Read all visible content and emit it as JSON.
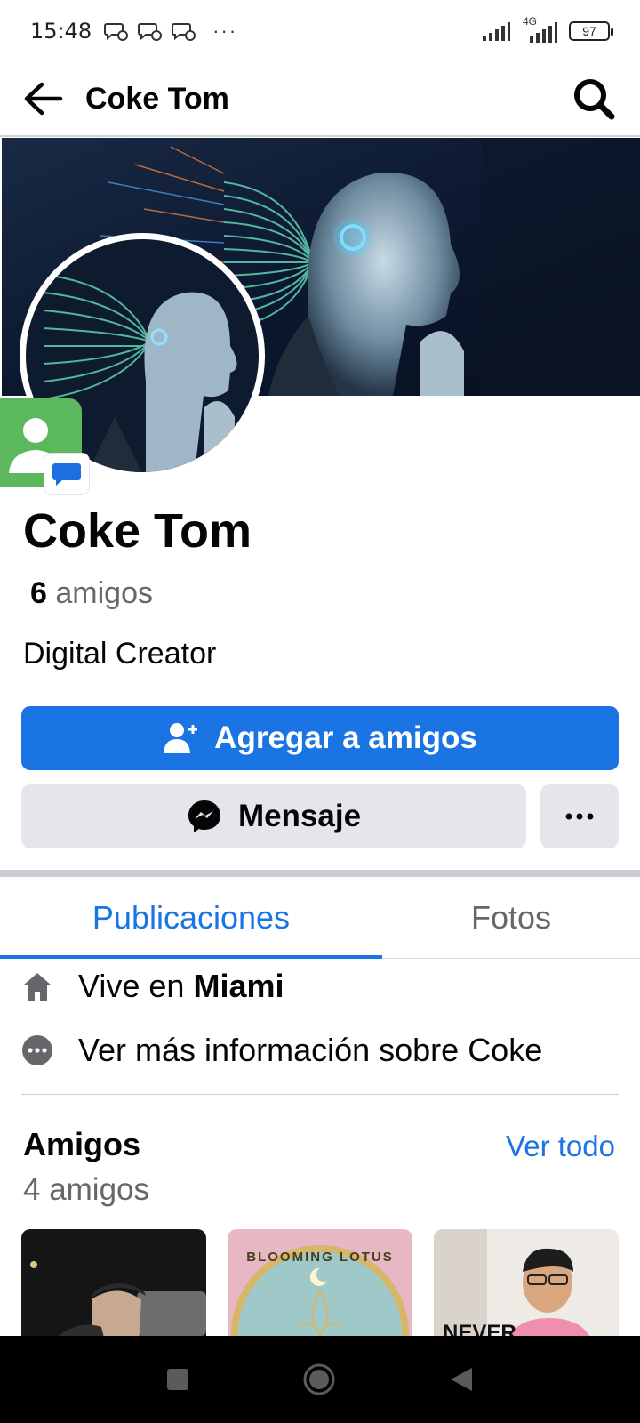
{
  "status_bar": {
    "time": "15:48",
    "more": "···",
    "network": "4G",
    "battery": "97"
  },
  "top_bar": {
    "title": "Coke Tom"
  },
  "profile": {
    "name": "Coke Tom",
    "friends_count": "6",
    "friends_label": "amigos",
    "bio": "Digital Creator"
  },
  "actions": {
    "add_friend": "Agregar a amigos",
    "message": "Mensaje",
    "more": "···"
  },
  "tabs": [
    {
      "label": "Publicaciones",
      "active": true
    },
    {
      "label": "Fotos",
      "active": false
    }
  ],
  "details": {
    "lives_prefix": "Vive en",
    "lives_city": "Miami",
    "more_info": "Ver más información sobre Coke"
  },
  "friends_section": {
    "title": "Amigos",
    "see_all": "Ver todo",
    "count_text": "4 amigos"
  },
  "friend_cards": [
    {
      "image": "older-man-cap-night-photo"
    },
    {
      "image": "blooming-lotus-logo",
      "logo_text": "BLOOMING LOTUS"
    },
    {
      "image": "smiling-man-glasses-photo",
      "overlay_text": "NEVER"
    }
  ],
  "colors": {
    "primary": "#1b74e4",
    "button_gray": "#e4e6eb",
    "secondary_text": "#65676b"
  }
}
